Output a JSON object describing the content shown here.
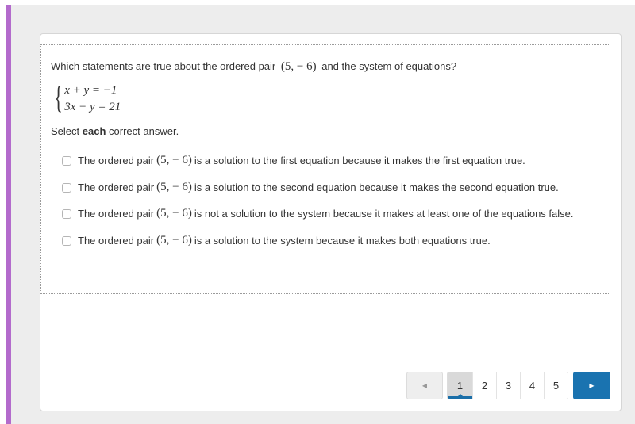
{
  "question": {
    "prompt_before": "Which statements are true about the ordered pair",
    "pair": "(5,  − 6)",
    "prompt_after": "and the system of equations?",
    "equations": [
      "x + y = −1",
      "3x − y = 21"
    ],
    "instruction_pre": "Select",
    "instruction_bold": "each",
    "instruction_post": "correct answer."
  },
  "options": [
    {
      "pre": "The ordered pair",
      "pair": "(5,  − 6)",
      "post": "is a solution to the first equation because it makes the first equation true.",
      "checked": false
    },
    {
      "pre": "The ordered pair",
      "pair": "(5,  − 6)",
      "post": "is a solution to the second equation because it makes the second equation true.",
      "checked": false
    },
    {
      "pre": "The ordered pair",
      "pair": "(5,  − 6)",
      "post": "is not a solution to the system because it makes at least one of the equations false.",
      "checked": false
    },
    {
      "pre": "The ordered pair",
      "pair": "(5,  − 6)",
      "post": "is a solution to the system because it makes both equations true.",
      "checked": false
    }
  ],
  "pagination": {
    "prev_icon": "◀",
    "next_icon": "▶",
    "pages": [
      "1",
      "2",
      "3",
      "4",
      "5"
    ],
    "current": "1"
  },
  "colors": {
    "accent_bar": "#b36bcc",
    "primary": "#1a73b0"
  }
}
